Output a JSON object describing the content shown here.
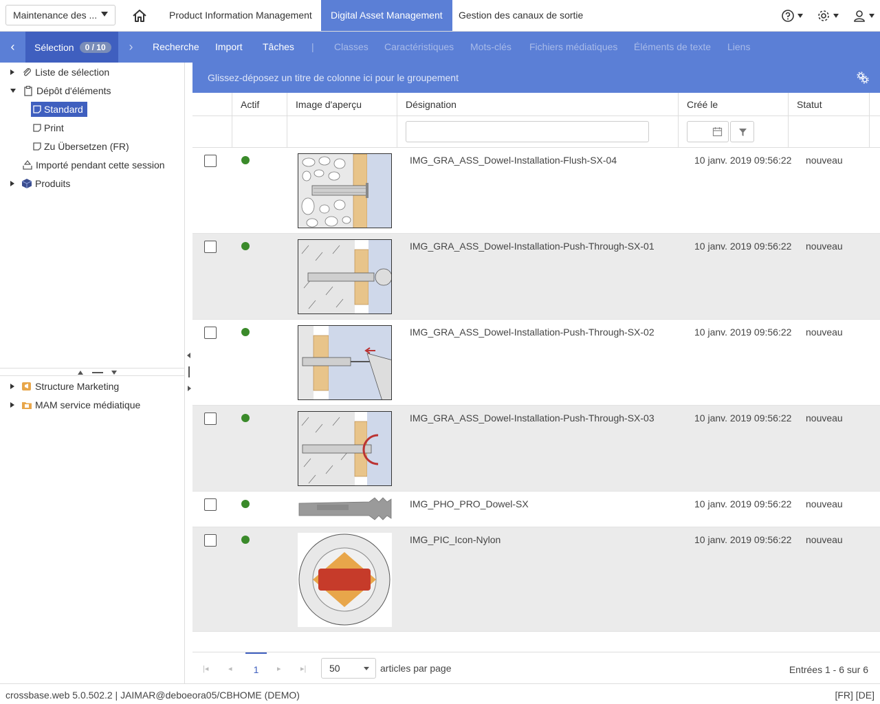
{
  "topbar": {
    "app_select": "Maintenance des ...",
    "tabs": [
      {
        "label": "Product Information Management"
      },
      {
        "label": "Digital Asset Management"
      },
      {
        "label": "Gestion des canaux de sortie"
      }
    ],
    "icons": [
      "home-icon",
      "help-icon",
      "gear-icon",
      "user-icon"
    ]
  },
  "navbar": {
    "selection_label": "Sélection",
    "selection_count": "0 / 10",
    "items": [
      "Recherche",
      "Import",
      "Tâches",
      "|"
    ],
    "dim_items": [
      "Classes",
      "Caractéristiques",
      "Mots-clés",
      "Fichiers médiatiques",
      "Éléments de texte",
      "Liens"
    ]
  },
  "tree": {
    "top": [
      {
        "label": "Liste de sélection"
      },
      {
        "label": "Dépôt d'éléments"
      },
      {
        "label": "Standard"
      },
      {
        "label": "Print"
      },
      {
        "label": "Zu Übersetzen (FR)"
      },
      {
        "label": "Importé pendant cette session"
      },
      {
        "label": "Produits"
      }
    ],
    "bottom": [
      {
        "label": "Structure Marketing"
      },
      {
        "label": "MAM service médiatique"
      }
    ]
  },
  "grid": {
    "group_hint": "Glissez-déposez un titre de colonne ici pour le groupement",
    "columns": [
      "Actif",
      "Image d'aperçu",
      "Désignation",
      "Créé le",
      "Statut"
    ],
    "rows": [
      {
        "name": "IMG_GRA_ASS_Dowel-Installation-Flush-SX-04",
        "created": "10 janv. 2019 09:56:22",
        "status": "nouveau"
      },
      {
        "name": "IMG_GRA_ASS_Dowel-Installation-Push-Through-SX-01",
        "created": "10 janv. 2019 09:56:22",
        "status": "nouveau"
      },
      {
        "name": "IMG_GRA_ASS_Dowel-Installation-Push-Through-SX-02",
        "created": "10 janv. 2019 09:56:22",
        "status": "nouveau"
      },
      {
        "name": "IMG_GRA_ASS_Dowel-Installation-Push-Through-SX-03",
        "created": "10 janv. 2019 09:56:22",
        "status": "nouveau"
      },
      {
        "name": "IMG_PHO_PRO_Dowel-SX",
        "created": "10 janv. 2019 09:56:22",
        "status": "nouveau"
      },
      {
        "name": "IMG_PIC_Icon-Nylon",
        "created": "10 janv. 2019 09:56:22",
        "status": "nouveau"
      }
    ]
  },
  "pager": {
    "current_page": "1",
    "page_size": "50",
    "page_size_label": "articles par page",
    "entries": "Entrées 1 - 6 sur 6"
  },
  "statusbar": {
    "left": "crossbase.web 5.0.502.2 | JAIMAR@deboeora05/CBHOME (DEMO)",
    "right": "[FR] [DE]"
  },
  "colors": {
    "accent": "#5b7fd6",
    "accent_dark": "#3f5fbf",
    "active_dot": "#3a8a2a"
  }
}
